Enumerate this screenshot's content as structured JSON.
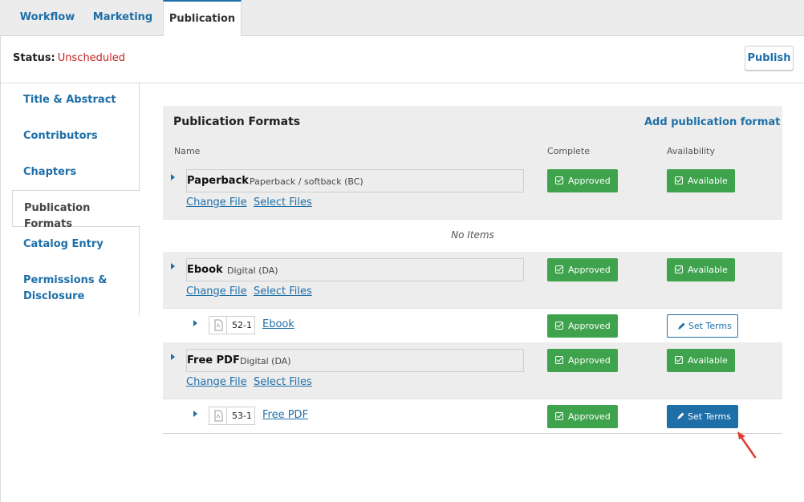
{
  "tabs": {
    "workflow": "Workflow",
    "marketing": "Marketing",
    "publication": "Publication"
  },
  "status": {
    "label": "Status:",
    "value": "Unscheduled"
  },
  "publish_label": "Publish",
  "nav": [
    "Title & Abstract",
    "Contributors",
    "Chapters",
    "Publication Formats",
    "Catalog Entry",
    "Permissions &",
    "Disclosure"
  ],
  "panel": {
    "title": "Publication Formats",
    "add_label": "Add publication format",
    "columns": {
      "name": "Name",
      "complete": "Complete",
      "availability": "Availability"
    },
    "no_items": "No Items"
  },
  "formats": [
    {
      "name": "Paperback",
      "sub": "Paperback / softback (BC)",
      "change": "Change File",
      "select": "Select Files",
      "complete": "Approved",
      "availability": "Available"
    },
    {
      "name": "Ebook",
      "sub": "Digital (DA)",
      "change": "Change File",
      "select": "Select Files",
      "complete": "Approved",
      "availability": "Available"
    },
    {
      "name": "Free PDF",
      "sub": "Digital (DA)",
      "change": "Change File",
      "select": "Select Files",
      "complete": "Approved",
      "availability": "Available"
    }
  ],
  "files": [
    {
      "id": "52-1",
      "name": "Ebook",
      "complete": "Approved",
      "terms": "Set Terms"
    },
    {
      "id": "53-1",
      "name": "Free PDF",
      "complete": "Approved",
      "terms": "Set Terms"
    }
  ],
  "colors": {
    "accent": "#1e6fa8",
    "approved": "#3fa34d",
    "status_red": "#c4221f"
  },
  "icons": [
    "check-square-icon",
    "pencil-icon",
    "pdf-file-icon",
    "caret-right-icon",
    "red-arrow-annotation"
  ]
}
